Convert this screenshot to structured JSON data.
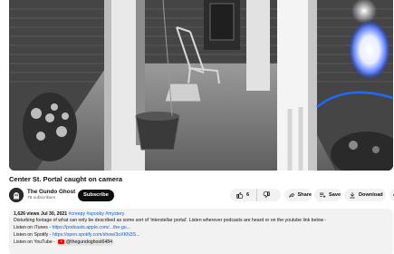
{
  "video": {
    "title": "Center St. Portal caught on camera"
  },
  "channel": {
    "name": "The Gundo Ghost",
    "subscribers": "78 subscribers",
    "subscribe_label": "Subscribe"
  },
  "actions": {
    "like_count": "6",
    "share_label": "Share",
    "save_label": "Save",
    "download_label": "Download"
  },
  "description": {
    "views": "1,626 views",
    "date": "Jul 30, 2021",
    "tags": "#creepy #spooky #mystery",
    "text": "Disturbing footage of what can only be described as some sort of 'interstellar portal'.  Listen wherever podcasts are heard or on the youtube link below -",
    "itunes_label": "Listen on iTunes - ",
    "itunes_link": "https://podcasts.apple.com/...the-gu...",
    "spotify_label": "Listen on Spotify - ",
    "spotify_link": "https://open.spotify.com/show/3oXKN3S...",
    "youtube_label": "Listen on YouTube - ",
    "youtube_handle": "@thegundoghost6484"
  },
  "icons": {
    "like": "thumbs-up-icon",
    "dislike": "thumbs-down-icon",
    "share": "share-arrow-icon",
    "save": "save-playlist-icon",
    "download": "download-icon",
    "more": "more-horizontal-icon"
  },
  "colors": {
    "link": "#065fd4",
    "subscribe_bg": "#0f0f0f",
    "pill_bg": "#f2f2f2",
    "portal": "#5b7fff"
  }
}
